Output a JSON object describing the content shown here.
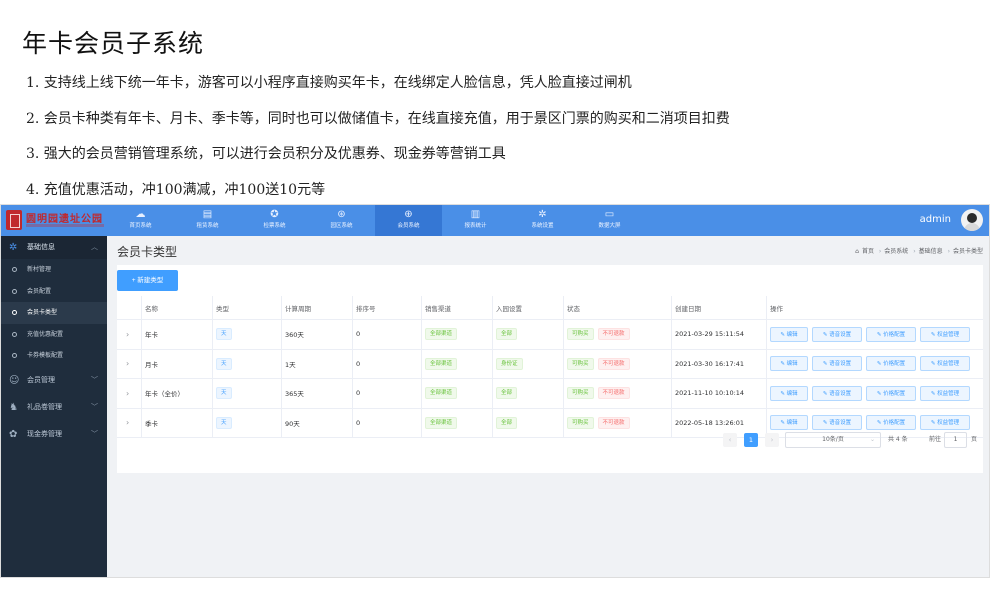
{
  "slide": {
    "title": "年卡会员子系统",
    "bullets": [
      "1.  支持线上线下统一年卡，游客可以小程序直接购买年卡，在线绑定人脸信息，凭人脸直接过闸机",
      "2.  会员卡种类有年卡、月卡、季卡等，同时也可以做储值卡，在线直接充值，用于景区门票的购买和二消项目扣费",
      "3. 强大的会员营销管理系统，可以进行会员积分及优惠券、现金券等营销工具",
      "4. 充值优惠活动，冲100满减，冲100送10元等"
    ]
  },
  "app": {
    "logo_text": "圆明园遗址公园",
    "nav": [
      {
        "label": "首页系统",
        "icon": "dashboard-icon"
      },
      {
        "label": "租赁系统",
        "icon": "document-icon"
      },
      {
        "label": "检票系统",
        "icon": "ticket-check-icon"
      },
      {
        "label": "园区系统",
        "icon": "park-icon"
      },
      {
        "label": "会员系统",
        "icon": "member-icon"
      },
      {
        "label": "报表统计",
        "icon": "bar-chart-icon"
      },
      {
        "label": "系统设置",
        "icon": "gear-icon"
      },
      {
        "label": "数据大屏",
        "icon": "monitor-icon"
      }
    ],
    "nav_active_index": 4,
    "user": "admin"
  },
  "sidebar": {
    "groups": [
      {
        "label": "基础信息",
        "icon": "gear-icon",
        "open": true,
        "items": [
          {
            "label": "新村管理",
            "active": false
          },
          {
            "label": "会员配置",
            "active": false
          },
          {
            "label": "会员卡类型",
            "active": true
          },
          {
            "label": "充值优惠配置",
            "active": false
          },
          {
            "label": "卡券模板配置",
            "active": false
          }
        ]
      },
      {
        "label": "会员管理",
        "icon": "user-icon",
        "open": false
      },
      {
        "label": "礼品卷管理",
        "icon": "gift-icon",
        "open": false
      },
      {
        "label": "现金券管理",
        "icon": "coupon-icon",
        "open": false
      }
    ]
  },
  "main": {
    "title": "会员卡类型",
    "breadcrumb": [
      "首页",
      "会员系统",
      "基础信息",
      "会员卡类型"
    ],
    "new_button": "+ 新建类型",
    "columns": [
      "名称",
      "类型",
      "计算周期",
      "排序号",
      "销售渠道",
      "入园设置",
      "状态",
      "创建日期",
      "操作"
    ],
    "rows": [
      {
        "name": "年卡",
        "type": "天",
        "period": "360天",
        "sort": "0",
        "channel": "全部渠道",
        "entry": "全部",
        "status1": "可购买",
        "status2": "不可退款",
        "date": "2021-03-29 15:11:54"
      },
      {
        "name": "月卡",
        "type": "天",
        "period": "1天",
        "sort": "0",
        "channel": "全部渠道",
        "entry": "身份证",
        "status1": "可购买",
        "status2": "不可退款",
        "date": "2021-03-30 16:17:41"
      },
      {
        "name": "年卡（全价）",
        "type": "天",
        "period": "365天",
        "sort": "0",
        "channel": "全部渠道",
        "entry": "全部",
        "status1": "可购买",
        "status2": "不可退款",
        "date": "2021-11-10 10:10:14"
      },
      {
        "name": "季卡",
        "type": "天",
        "period": "90天",
        "sort": "0",
        "channel": "全部渠道",
        "entry": "全部",
        "status1": "可购买",
        "status2": "不可退款",
        "date": "2022-05-18 13:26:01"
      }
    ],
    "actions": [
      "编辑",
      "语音设置",
      "价格配置",
      "权益管理"
    ],
    "pagination": {
      "current": "1",
      "page_size": "10条/页",
      "total": "共 4 条",
      "goto_prefix": "前往",
      "goto_value": "1",
      "goto_suffix": "页"
    }
  }
}
